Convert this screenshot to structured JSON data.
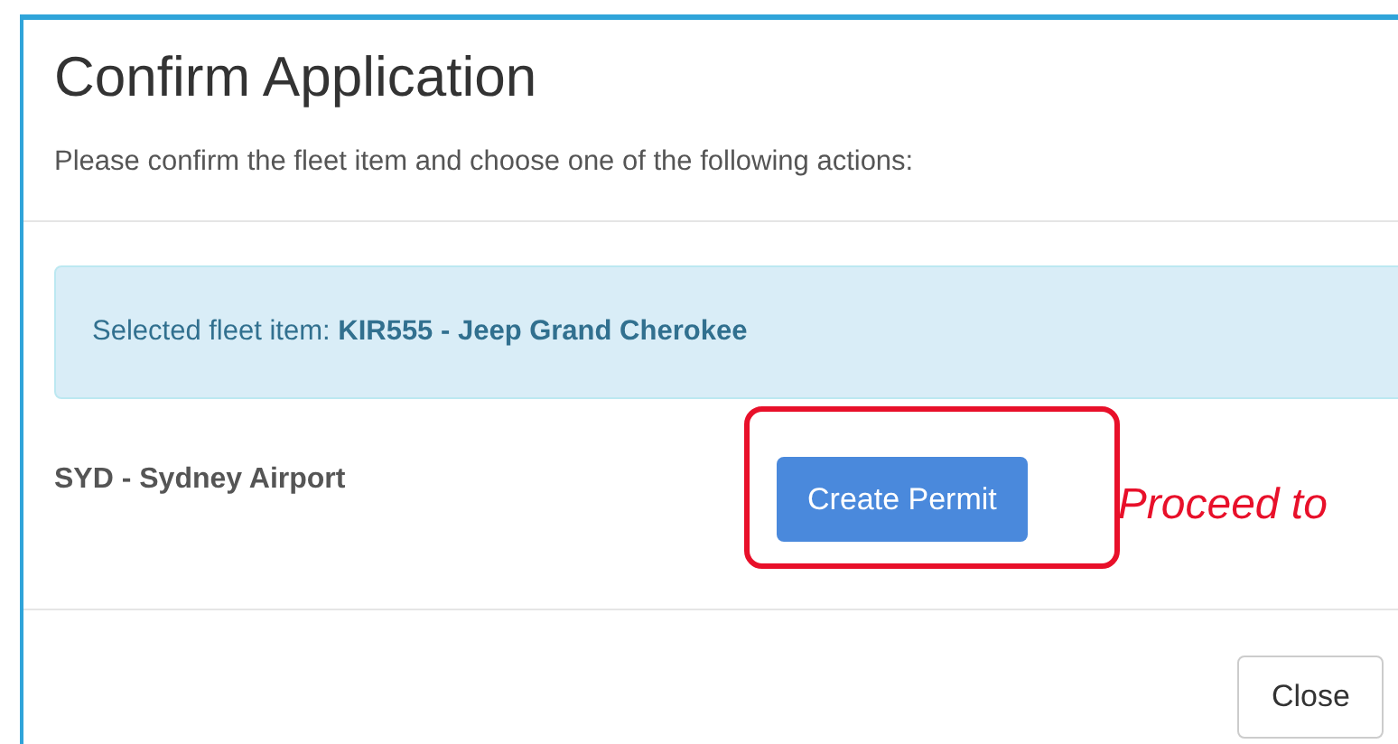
{
  "dialog": {
    "title": "Confirm Application",
    "subtitle": "Please confirm the fleet item and choose one of the following actions:"
  },
  "alert": {
    "label": "Selected fleet item:",
    "value": "KIR555 - Jeep Grand Cherokee"
  },
  "location": "SYD - Sydney Airport",
  "action_button": "Create Permit",
  "annotation": "Proceed to",
  "footer_buttons": [
    "Close"
  ]
}
